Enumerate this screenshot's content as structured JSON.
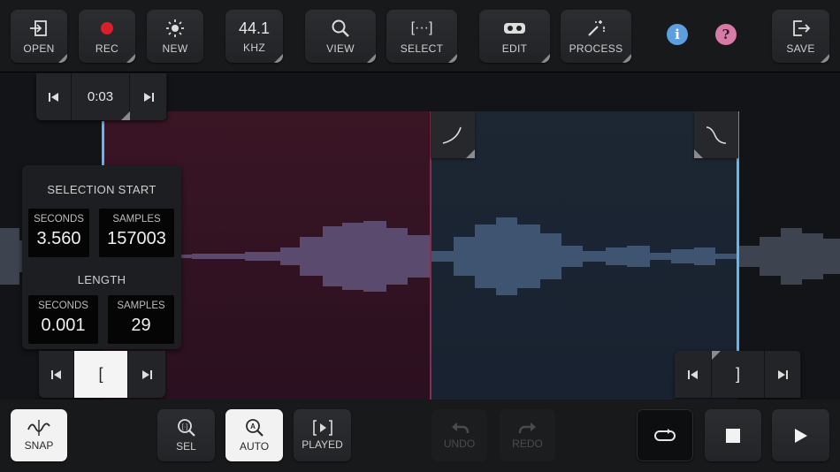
{
  "toolbar": {
    "open": "OPEN",
    "rec": "REC",
    "new": "NEW",
    "rate_value": "44.1",
    "rate_unit": "KHZ",
    "view": "VIEW",
    "select": "SELECT",
    "select_glyph": "[···]",
    "edit": "EDIT",
    "process": "PROCESS",
    "info_glyph": "i",
    "help_glyph": "?",
    "save": "SAVE"
  },
  "time_nav": {
    "current": "0:03"
  },
  "selection_panel": {
    "start_title": "SELECTION START",
    "start_seconds_label": "SECONDS",
    "start_seconds": "3.560",
    "start_samples_label": "SAMPLES",
    "start_samples": "157003",
    "length_title": "LENGTH",
    "length_seconds_label": "SECONDS",
    "length_seconds": "0.001",
    "length_samples_label": "SAMPLES",
    "length_samples": "29"
  },
  "left_marker_nav": {
    "bracket": "["
  },
  "right_marker_nav": {
    "bracket": "]"
  },
  "bottombar": {
    "snap": "SNAP",
    "sel": "SEL",
    "auto": "AUTO",
    "played": "PLAYED",
    "undo": "UNDO",
    "redo": "REDO"
  },
  "colors": {
    "selection": "#3a1524",
    "marker": "#5fb8ee",
    "info": "#5b9fe0",
    "help": "#d77aa6",
    "rec": "#d81f2a"
  }
}
